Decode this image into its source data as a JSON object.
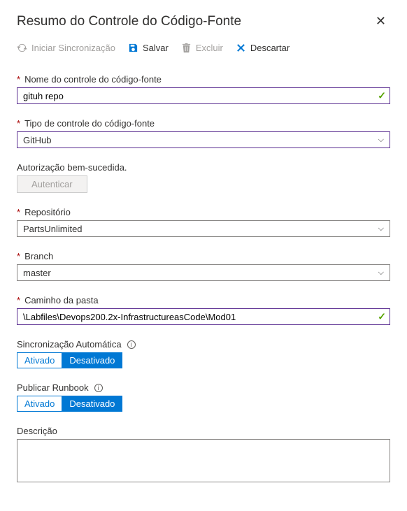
{
  "header": {
    "title": "Resumo do Controle do Código-Fonte"
  },
  "toolbar": {
    "sync": "Iniciar Sincronização",
    "save": "Salvar",
    "delete": "Excluir",
    "discard": "Descartar"
  },
  "fields": {
    "name": {
      "label": "Nome do controle do código-fonte",
      "value": "gituh repo"
    },
    "type": {
      "label": "Tipo de controle do código-fonte",
      "value": "GitHub"
    },
    "auth": {
      "status": "Autorização bem-sucedida.",
      "button": "Autenticar"
    },
    "repo": {
      "label": "Repositório",
      "value": "PartsUnlimited"
    },
    "branch": {
      "label": "Branch",
      "value": "master"
    },
    "folder": {
      "label": "Caminho da pasta",
      "value": "\\Labfiles\\Devops200.2x-InfrastructureasCode\\Mod01"
    },
    "autosync": {
      "label": "Sincronização Automática",
      "on": "Ativado",
      "off": "Desativado"
    },
    "publish": {
      "label": "Publicar Runbook",
      "on": "Ativado",
      "off": "Desativado"
    },
    "description": {
      "label": "Descrição",
      "value": ""
    }
  }
}
